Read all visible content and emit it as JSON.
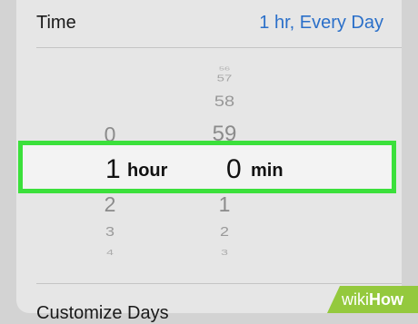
{
  "time": {
    "label": "Time",
    "value": "1 hr, Every Day"
  },
  "picker": {
    "hours_above": [
      "0"
    ],
    "hours_selected": "1",
    "hours_unit": "hour",
    "hours_below": [
      "2",
      "3",
      "4"
    ],
    "minutes_above": [
      "56",
      "57",
      "58",
      "59"
    ],
    "minutes_selected": "0",
    "minutes_unit": "min",
    "minutes_below": [
      "1",
      "2",
      "3"
    ]
  },
  "customize_label": "Customize Days",
  "watermark": {
    "wiki": "wiki",
    "how": "How"
  },
  "colors": {
    "accent": "#2a6fc9",
    "highlight_border": "#3be03b",
    "watermark_bg": "#94c93d"
  }
}
